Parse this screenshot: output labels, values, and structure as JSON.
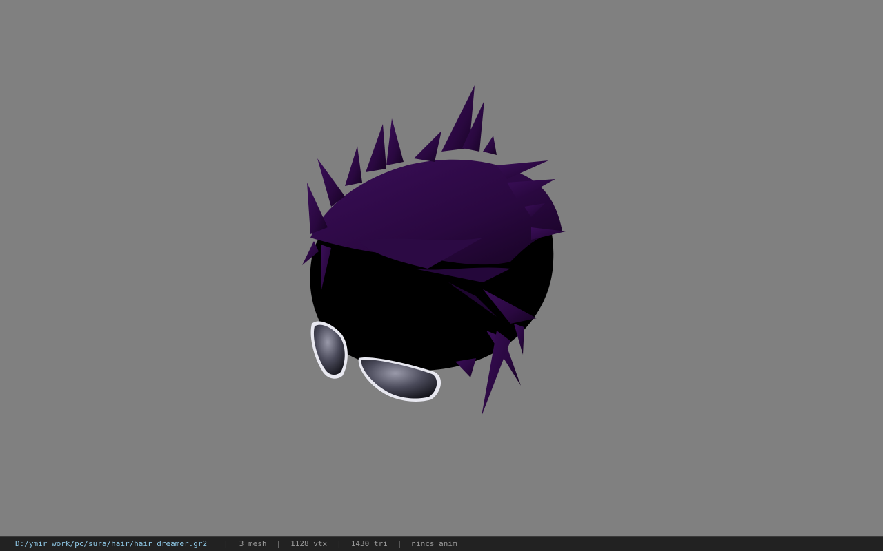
{
  "viewer": {
    "model_name": "hair_dreamer",
    "colors": {
      "background": "#808080",
      "hair_primary": "#3a0e57",
      "hair_dark": "#1a0428",
      "head": "#000000",
      "lens": "#5a5a6e"
    }
  },
  "status": {
    "file_path": "D:/ymir work/pc/sura/hair/hair_dreamer.gr2",
    "separator": "|",
    "mesh": "3 mesh",
    "vertices": "1128 vtx",
    "triangles": "1430 tri",
    "animation": "nincs anim"
  }
}
